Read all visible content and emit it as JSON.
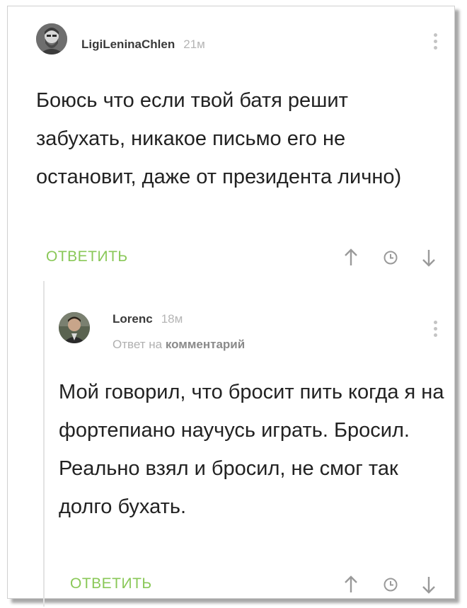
{
  "comments": [
    {
      "author": "LigiLeninaChlen",
      "time": "21м",
      "text": "Боюсь что если твой батя решит забухать, никакое письмо его не остановит, даже от президента лично)",
      "reply_label": "ОТВЕТИТЬ"
    },
    {
      "author": "Lorenc",
      "time": "18м",
      "reply_prefix": "Ответ на",
      "reply_target": "комментарий",
      "text": "Мой говорил, что бросит пить когда я на фортепиано научусь играть. Бросил. Реально взял и бросил, не смог так долго бухать.",
      "reply_label": "ОТВЕТИТЬ"
    }
  ],
  "colors": {
    "accent_green": "#8ac858",
    "muted_gray": "#b5b5b5",
    "icon_gray": "#9a9a9a"
  },
  "icons": [
    "more-vertical-icon",
    "arrow-up-icon",
    "clock-icon",
    "arrow-down-icon"
  ]
}
